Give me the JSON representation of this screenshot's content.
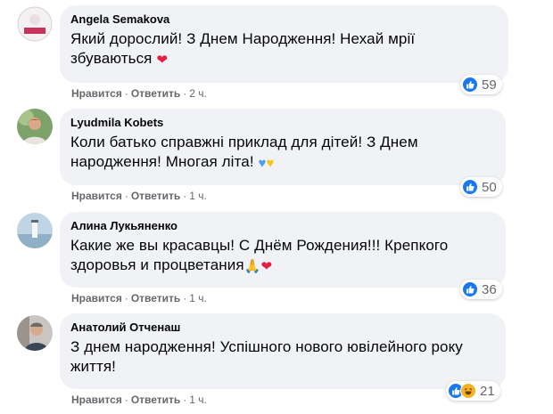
{
  "actions": {
    "like": "Нравится",
    "reply": "Ответить",
    "separator": "·"
  },
  "colors": {
    "bubble": "#f0f2f5",
    "meta": "#65676b",
    "like_blue": "#1877f2",
    "heart_red": "#e41e3f"
  },
  "comments": [
    {
      "author": "Angela Semakova",
      "text": "Який дорослий! З Днем Народження! Нехай мрії збуваються",
      "emoji": [
        "red-heart"
      ],
      "time": "2 ч.",
      "reaction_icons": [
        "like"
      ],
      "reaction_count": "59"
    },
    {
      "author": "Lyudmila Kobets",
      "text": "Коли батько справжні приклад для дітей! З Днем народження! Многая літа!",
      "emoji": [
        "blue-heart",
        "yellow-heart"
      ],
      "time": "1 ч.",
      "reaction_icons": [
        "like"
      ],
      "reaction_count": "50"
    },
    {
      "author": "Алина Лукьяненко",
      "text": "Какие же вы красавцы! С Днём Рождения!!! Крепкого здоровья и процветания",
      "emoji": [
        "folded-hands",
        "red-heart"
      ],
      "time": "1 ч.",
      "reaction_icons": [
        "like"
      ],
      "reaction_count": "36"
    },
    {
      "author": "Анатолий Отченаш",
      "text": "З днем народження! Успішного нового ювілейного року життя!",
      "emoji": [],
      "time": "1 ч.",
      "reaction_icons": [
        "like",
        "haha"
      ],
      "reaction_count": "21"
    }
  ]
}
